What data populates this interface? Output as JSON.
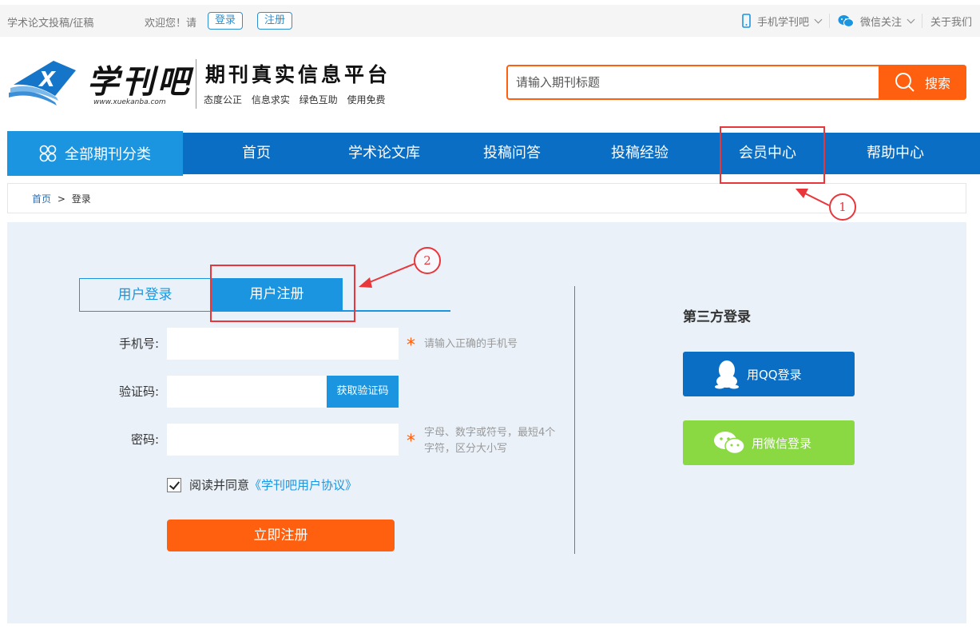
{
  "topbar": {
    "site_link": "学术论文投稿/征稿",
    "welcome": "欢迎您！请",
    "login_button": "登录",
    "register_button": "注册",
    "mobile": "手机学刊吧",
    "wechat": "微信关注",
    "about": "关于我们"
  },
  "header": {
    "logo_name": "学刊吧",
    "logo_url": "www.xuekanba.com",
    "slogan": "期刊真实信息平台",
    "subslogan": "态度公正 信息求实 绿色互助 使用免费",
    "search_placeholder": "请输入期刊标题",
    "search_button": "搜索"
  },
  "nav": {
    "all_categories": "全部期刊分类",
    "items": [
      "首页",
      "学术论文库",
      "投稿问答",
      "投稿经验",
      "会员中心",
      "帮助中心"
    ]
  },
  "breadcrumb": {
    "home": "首页",
    "separator": ">",
    "current": "登录"
  },
  "form": {
    "tab_login": "用户登录",
    "tab_register": "用户注册",
    "phone_label": "手机号:",
    "phone_hint": "请输入正确的手机号",
    "code_label": "验证码:",
    "code_button": "获取验证码",
    "password_label": "密码:",
    "password_hint": "字母、数字或符号，最短4个字符，区分大小写",
    "agree_text": "阅读并同意",
    "agree_link": "《学刊吧用户协议》",
    "submit": "立即注册",
    "agree_checked": true
  },
  "third_party": {
    "title": "第三方登录",
    "qq": "用QQ登录",
    "wechat": "用微信登录"
  },
  "annotations": {
    "marker_1": "1",
    "marker_2": "2"
  },
  "colors": {
    "primary_blue": "#0a6ec4",
    "light_blue": "#1b95e0",
    "orange": "#ff6010",
    "wechat_green": "#8ad942",
    "annotation_red": "#e8363a",
    "panel_bg": "#eaf1f9"
  }
}
